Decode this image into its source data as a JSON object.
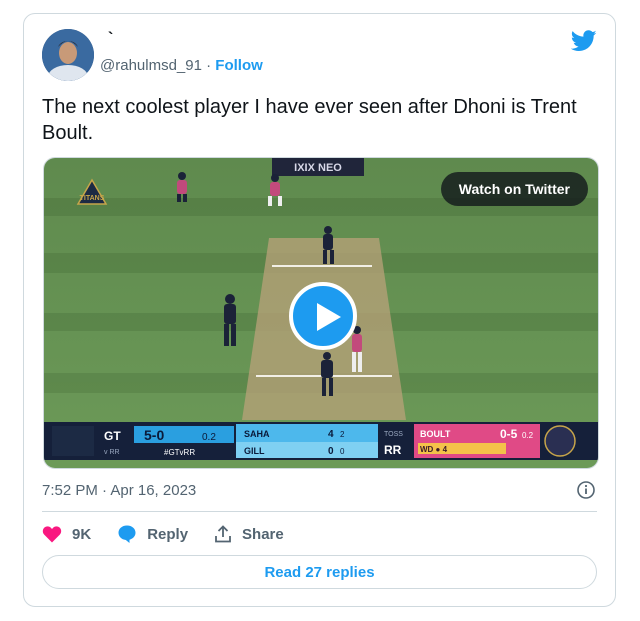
{
  "tweet": {
    "display_name": "`",
    "handle": "@rahulmsd_91",
    "separator": " · ",
    "follow_label": "Follow",
    "text": "The next coolest player I have ever seen after Dhoni is Trent Boult.",
    "timestamp": "7:52 PM · Apr 16, 2023"
  },
  "media": {
    "watch_label": "Watch on Twitter",
    "sponsor_text": "IXIX NEO",
    "scorebar": {
      "team": "GT",
      "score": "5-0",
      "overs": "0.2",
      "vs": "v RR",
      "hashtag": "#GTvRR",
      "batter1_name": "SAHA",
      "batter1_runs": "4",
      "batter1_balls": "2",
      "batter2_name": "GILL",
      "batter2_runs": "0",
      "batter2_balls": "0",
      "toss_label": "TOSS",
      "toss_team": "RR",
      "bowler_name": "BOULT",
      "bowler_figures": "0-5",
      "bowler_overs": "0.2",
      "this_over": "WD ● 4"
    }
  },
  "actions": {
    "like_count": "9K",
    "reply_label": "Reply",
    "share_label": "Share"
  },
  "read_replies_label": "Read 27 replies",
  "colors": {
    "accent": "#1d9bf0",
    "like": "#f91880",
    "text_secondary": "#536471",
    "border": "#cfd9de"
  }
}
